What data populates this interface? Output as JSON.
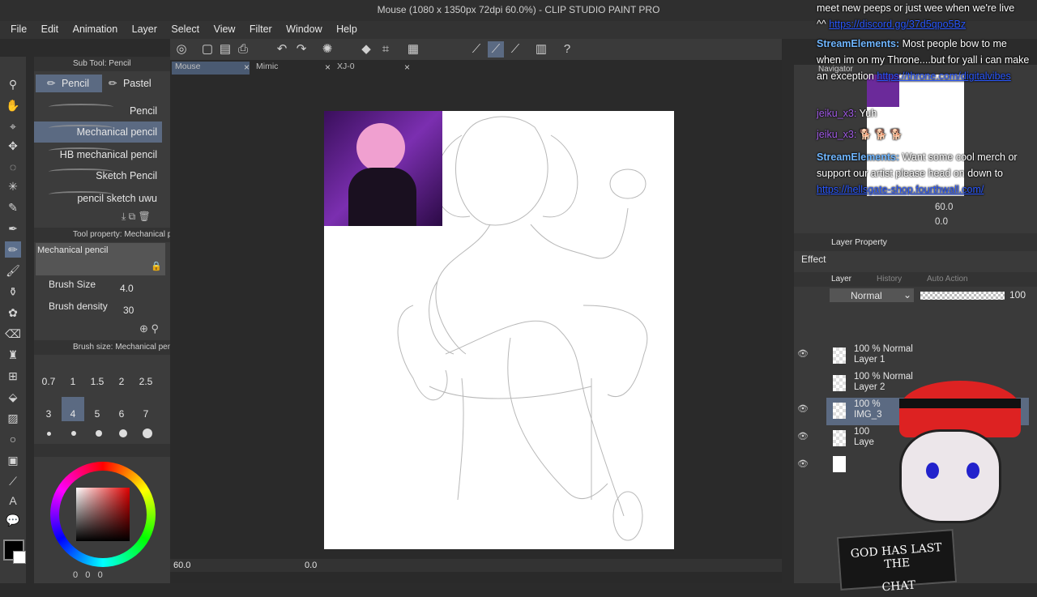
{
  "window": {
    "title": "Mouse (1080 x 1350px 72dpi 60.0%) - CLIP STUDIO PAINT PRO"
  },
  "menu": [
    "File",
    "Edit",
    "Animation",
    "Layer",
    "Select",
    "View",
    "Filter",
    "Window",
    "Help"
  ],
  "subtool": {
    "header": "Sub Tool: Pencil",
    "tabs": [
      "Pencil",
      "Pastel"
    ],
    "brushes": [
      "Pencil",
      "Mechanical pencil",
      "HB mechanical pencil",
      "Sketch Pencil",
      "pencil sketch uwu"
    ],
    "selected_index": 1
  },
  "tool_property": {
    "header": "Tool property: Mechanical p",
    "brush_name": "Mechanical pencil",
    "brush_size_label": "Brush Size",
    "brush_size_value": "4.0",
    "brush_density_label": "Brush density",
    "brush_density_value": "30"
  },
  "brush_size_panel": {
    "header": "Brush size: Mechanical penc",
    "sizes": [
      "0.7",
      "1",
      "1.5",
      "2",
      "2.5",
      "3",
      "4",
      "5",
      "6",
      "7"
    ],
    "selected": "4"
  },
  "documents": {
    "tabs": [
      "Mouse",
      "Mimic",
      "XJ-0"
    ],
    "active": "Mouse"
  },
  "status": {
    "zoom": "60.0",
    "rotation": "0.0"
  },
  "color_fields": {
    "a": "0",
    "b": "0",
    "c": "0"
  },
  "navigator": {
    "title": "Navigator",
    "zoom": "60.0",
    "rotate": "0.0"
  },
  "chat": {
    "line0": "meet new peeps or just wee when we're live",
    "line0_link": "https://discord.gg/37d5qpo5Bz",
    "m1_name": "StreamElements:",
    "m1_text": "Most people bow to me when im on my Throne....but for yall i can make an exception",
    "m1_link": "https://throne.com/digitalvibes",
    "m2_name": "jeiku_x3:",
    "m2_text": "Yuh",
    "m3_name": "jeiku_x3:",
    "m4_name": "StreamElements:",
    "m4_text": "Want some cool merch or support our artist please head on down to",
    "m4_link": "https://hellsgate-shop.fourthwall.com/"
  },
  "layer_property": {
    "title": "Layer Property",
    "effect": "Effect"
  },
  "layer_panel": {
    "tabs": [
      "Layer",
      "History",
      "Auto Action"
    ],
    "blend_mode": "Normal",
    "opacity": "100",
    "layers": [
      {
        "top": "100 % Normal",
        "name": "Layer 1"
      },
      {
        "top": "100 % Normal",
        "name": "Layer 2"
      },
      {
        "top": "100 %",
        "name": "IMG_3"
      },
      {
        "top": "100",
        "name": "Laye"
      },
      {
        "top": "",
        "name": ""
      }
    ]
  },
  "overlay": {
    "sign_line1": "GOD HAS LAST THE",
    "sign_line2": "CHAT"
  }
}
